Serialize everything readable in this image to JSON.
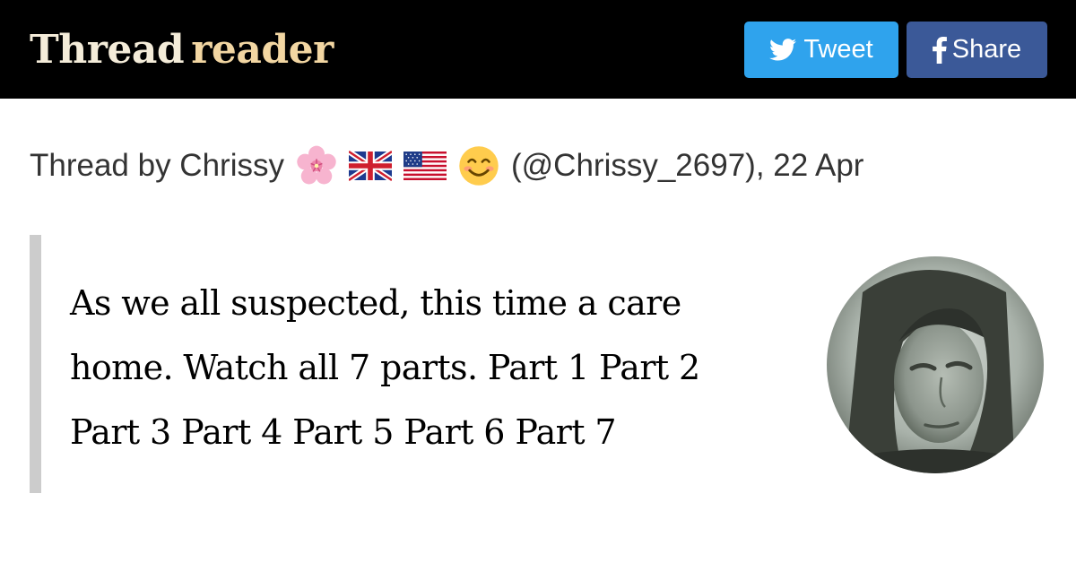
{
  "header": {
    "logo_word1": "Thread",
    "logo_word2": "reader",
    "tweet_label": "Tweet",
    "share_label": "Share",
    "colors": {
      "bar": "#000000",
      "tweet": "#2fa3ed",
      "share": "#3b5998"
    }
  },
  "thread": {
    "prefix": "Thread by Chrissy",
    "emojis": [
      "cherry-blossom-icon",
      "uk-flag-icon",
      "us-flag-icon",
      "smiling-face-icon"
    ],
    "suffix": "(@Chrissy_2697), 22 Apr"
  },
  "tweet": {
    "text": "As we all suspected, this time a care home. Watch all 7 parts. Part 1 Part 2 Part 3 Part 4 Part 5 Part 6 Part 7"
  },
  "avatar": {
    "icon": "author-avatar"
  }
}
